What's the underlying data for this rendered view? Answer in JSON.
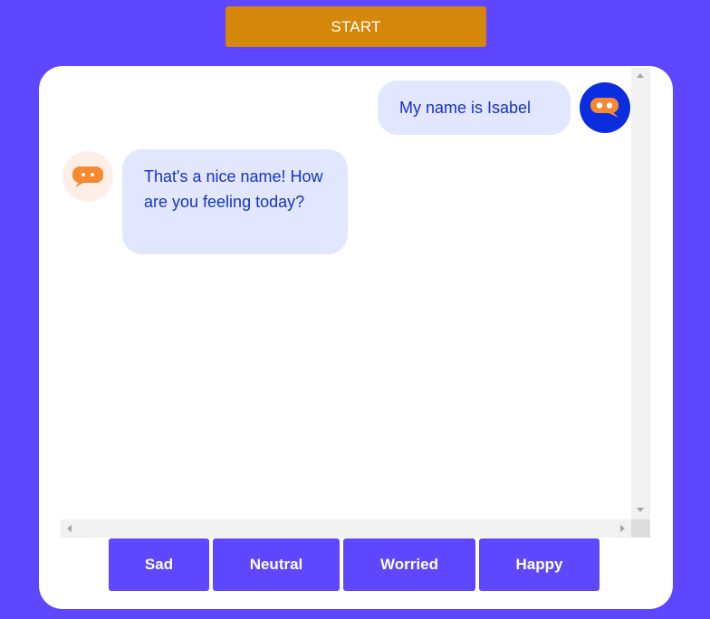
{
  "header": {
    "start_label": "START"
  },
  "chat": {
    "messages": [
      {
        "sender": "user",
        "text": "My name is Isabel"
      },
      {
        "sender": "bot",
        "text": "That's a nice name! How are you feeling today?"
      }
    ],
    "avatar_icon": "chat-bubble-icon"
  },
  "options": [
    {
      "label": "Sad"
    },
    {
      "label": "Neutral"
    },
    {
      "label": "Worried"
    },
    {
      "label": "Happy"
    }
  ],
  "colors": {
    "background": "#5f46ff",
    "start_button": "#d4870a",
    "bubble": "#e2e6fe",
    "bubble_text": "#1534c9",
    "user_avatar": "#0a2de0",
    "bot_avatar": "#fdefe6",
    "icon": "#f5892f"
  }
}
